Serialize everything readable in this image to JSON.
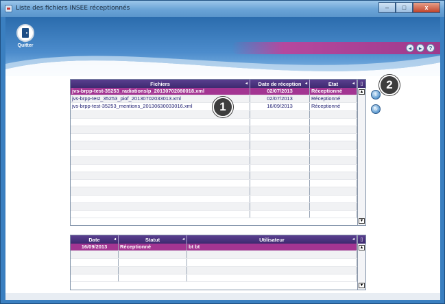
{
  "window": {
    "title": "Liste des fichiers INSEE réceptionnés"
  },
  "window_controls": {
    "minimize": "–",
    "maximize": "□",
    "close": "x"
  },
  "header": {
    "quit_label": "Quitter",
    "icons": [
      {
        "name": "back-icon",
        "glyph": "◂"
      },
      {
        "name": "forward-icon",
        "glyph": "▸"
      },
      {
        "name": "help-icon",
        "glyph": "?"
      }
    ],
    "accent_color": "#a33592"
  },
  "files_grid": {
    "columns": [
      "Fichiers",
      "Date de réception",
      "Etat"
    ],
    "rows": [
      {
        "file": "jvs-brpp-test-35253_radiationslp_20130702080018.xml",
        "date": "02/07/2013",
        "status": "Réceptionné",
        "selected": true
      },
      {
        "file": "jvs-brpp-test_35253_piof_20130702033013.xml",
        "date": "02/07/2013",
        "status": "Réceptionné",
        "selected": false
      },
      {
        "file": "jvs-brpp-test-35253_mentions_20130630033016.xml",
        "date": "16/09/2013",
        "status": "Réceptionné",
        "selected": false
      }
    ],
    "empty_rows": 14
  },
  "history_grid": {
    "columns": [
      "Date",
      "Statut",
      "Utilisateur"
    ],
    "rows": [
      {
        "date": "16/09/2013",
        "status": "Réceptionné",
        "user": "bt bt",
        "selected": true
      }
    ],
    "empty_rows": 4
  },
  "side_actions": [
    {
      "name": "integrate-button-icon",
      "glyph": "⇩"
    },
    {
      "name": "refresh-button-icon",
      "glyph": "↻"
    }
  ],
  "callouts": [
    "1",
    "2"
  ]
}
